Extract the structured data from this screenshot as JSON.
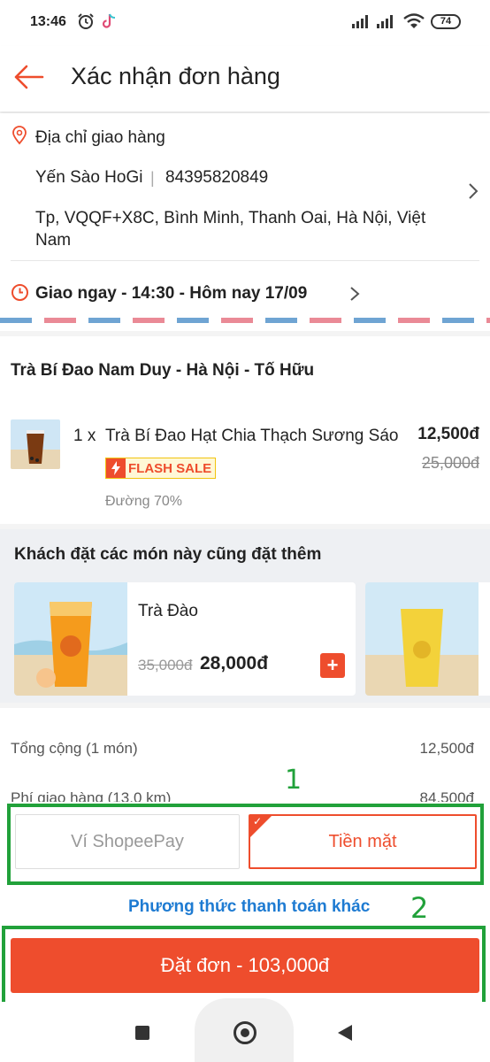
{
  "status_bar": {
    "time": "13:46",
    "battery": "74",
    "icons": [
      "alarm-icon",
      "tiktok-icon",
      "signal-icon",
      "signal-icon",
      "wifi-icon",
      "battery-icon"
    ]
  },
  "header": {
    "title": "Xác nhận đơn hàng",
    "back_icon": "back-arrow-icon"
  },
  "address": {
    "heading": "Địa chỉ giao hàng",
    "name": "Yến Sào HoGi",
    "separator": "|",
    "phone": "84395820849",
    "line": "Tp, VQQF+X8C, Bình Minh, Thanh Oai, Hà Nội, Việt Nam"
  },
  "delivery": {
    "time_label": "Giao ngay - 14:30 - Hôm nay 17/09"
  },
  "shop": {
    "name": "Trà Bí Đao Nam Duy - Hà Nội - Tố Hữu",
    "item": {
      "qty": "1 x",
      "name": "Trà Bí Đao Hạt Chia Thạch Sương Sáo",
      "price": "12,500đ",
      "old_price": "25,000đ",
      "badge": "FLASH SALE",
      "note": "Đường 70%"
    }
  },
  "suggestions": {
    "title": "Khách đặt các món này cũng đặt thêm",
    "items": [
      {
        "name": "Trà Đào",
        "old_price": "35,000đ",
        "price": "28,000đ",
        "add": "+"
      }
    ]
  },
  "summary": {
    "rows": [
      {
        "label": "Tổng cộng (1 món)",
        "value": "12,500đ"
      },
      {
        "label": "Phí giao hàng (13.0 km)",
        "value": "84,500đ"
      }
    ]
  },
  "annotations": {
    "one": "1",
    "two": "2",
    "color": "#21a13a"
  },
  "payment": {
    "options": [
      {
        "label": "Ví ShopeePay",
        "selected": false
      },
      {
        "label": "Tiền mặt",
        "selected": true
      }
    ],
    "other_label": "Phương thức thanh toán khác",
    "order_button": "Đặt đơn - 103,000đ"
  },
  "colors": {
    "accent": "#ee4d2d",
    "link": "#1e7bd2",
    "annotation": "#21a13a"
  }
}
